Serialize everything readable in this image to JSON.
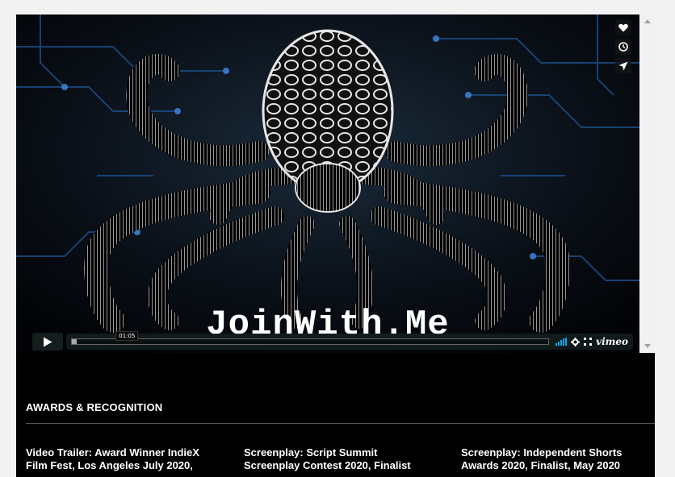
{
  "video": {
    "overlay_title": "JoinWith.Me",
    "time_tip": "01:05",
    "progress_fraction": 0.01,
    "volume_level": 1.0,
    "vimeo_label": "vimeo",
    "side_actions": [
      {
        "name": "heart-icon",
        "glyph": "❤"
      },
      {
        "name": "clock-icon",
        "glyph": "◷"
      },
      {
        "name": "send-icon",
        "glyph": "➤"
      }
    ],
    "accent_color": "#00adef"
  },
  "awards": {
    "heading": "AWARDS & RECOGNITION",
    "items": [
      {
        "line1": "Video Trailer: Award Winner IndieX",
        "line2": "Film Fest, Los Angeles July 2020,"
      },
      {
        "line1": "Screenplay: Script Summit",
        "line2": "Screenplay Contest 2020, Finalist"
      },
      {
        "line1": "Screenplay: Independent Shorts",
        "line2": "Awards 2020, Finalist, May 2020"
      }
    ]
  }
}
